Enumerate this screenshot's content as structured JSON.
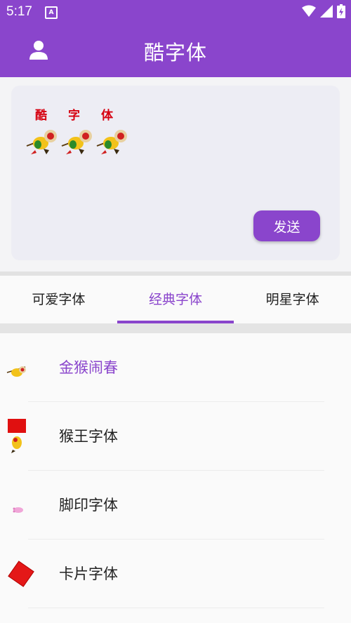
{
  "status_bar": {
    "time": "5:17",
    "notification_icon": "A"
  },
  "app_bar": {
    "title": "酷字体",
    "avatar_icon": "person-icon"
  },
  "preview": {
    "characters": [
      "酷",
      "字",
      "体"
    ],
    "send_label": "发送"
  },
  "tabs": [
    {
      "label": "可爱字体",
      "active": false
    },
    {
      "label": "经典字体",
      "active": true
    },
    {
      "label": "明星字体",
      "active": false
    }
  ],
  "font_list": [
    {
      "label": "金猴闹春",
      "thumb": "monkey-icon",
      "selected": true
    },
    {
      "label": "猴王字体",
      "thumb": "monkey-king-icon",
      "selected": false
    },
    {
      "label": "脚印字体",
      "thumb": "footprint-icon",
      "selected": false
    },
    {
      "label": "卡片字体",
      "thumb": "card-icon",
      "selected": false
    }
  ],
  "colors": {
    "accent": "#8a45cc",
    "preview_text": "#d60010"
  }
}
